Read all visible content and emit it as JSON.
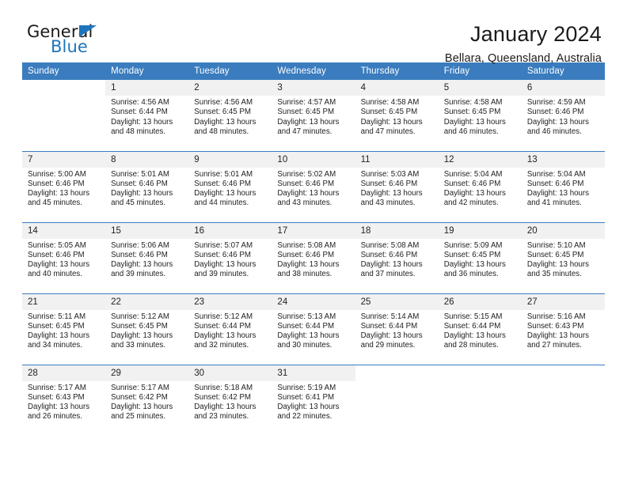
{
  "brand": {
    "name_part1": "General",
    "name_part2": "Blue",
    "accent_color": "#1c75bc"
  },
  "header": {
    "title": "January 2024",
    "subtitle": "Bellara, Queensland, Australia"
  },
  "theme": {
    "header_row_color": "#3a7cbe",
    "daynum_band_color": "#f1f1f1",
    "text_color": "#222222"
  },
  "weekday_headers": [
    "Sunday",
    "Monday",
    "Tuesday",
    "Wednesday",
    "Thursday",
    "Friday",
    "Saturday"
  ],
  "weeks": [
    [
      {
        "day": "",
        "lines": []
      },
      {
        "day": "1",
        "lines": [
          "Sunrise: 4:56 AM",
          "Sunset: 6:44 PM",
          "Daylight: 13 hours",
          "and 48 minutes."
        ]
      },
      {
        "day": "2",
        "lines": [
          "Sunrise: 4:56 AM",
          "Sunset: 6:45 PM",
          "Daylight: 13 hours",
          "and 48 minutes."
        ]
      },
      {
        "day": "3",
        "lines": [
          "Sunrise: 4:57 AM",
          "Sunset: 6:45 PM",
          "Daylight: 13 hours",
          "and 47 minutes."
        ]
      },
      {
        "day": "4",
        "lines": [
          "Sunrise: 4:58 AM",
          "Sunset: 6:45 PM",
          "Daylight: 13 hours",
          "and 47 minutes."
        ]
      },
      {
        "day": "5",
        "lines": [
          "Sunrise: 4:58 AM",
          "Sunset: 6:45 PM",
          "Daylight: 13 hours",
          "and 46 minutes."
        ]
      },
      {
        "day": "6",
        "lines": [
          "Sunrise: 4:59 AM",
          "Sunset: 6:46 PM",
          "Daylight: 13 hours",
          "and 46 minutes."
        ]
      }
    ],
    [
      {
        "day": "7",
        "lines": [
          "Sunrise: 5:00 AM",
          "Sunset: 6:46 PM",
          "Daylight: 13 hours",
          "and 45 minutes."
        ]
      },
      {
        "day": "8",
        "lines": [
          "Sunrise: 5:01 AM",
          "Sunset: 6:46 PM",
          "Daylight: 13 hours",
          "and 45 minutes."
        ]
      },
      {
        "day": "9",
        "lines": [
          "Sunrise: 5:01 AM",
          "Sunset: 6:46 PM",
          "Daylight: 13 hours",
          "and 44 minutes."
        ]
      },
      {
        "day": "10",
        "lines": [
          "Sunrise: 5:02 AM",
          "Sunset: 6:46 PM",
          "Daylight: 13 hours",
          "and 43 minutes."
        ]
      },
      {
        "day": "11",
        "lines": [
          "Sunrise: 5:03 AM",
          "Sunset: 6:46 PM",
          "Daylight: 13 hours",
          "and 43 minutes."
        ]
      },
      {
        "day": "12",
        "lines": [
          "Sunrise: 5:04 AM",
          "Sunset: 6:46 PM",
          "Daylight: 13 hours",
          "and 42 minutes."
        ]
      },
      {
        "day": "13",
        "lines": [
          "Sunrise: 5:04 AM",
          "Sunset: 6:46 PM",
          "Daylight: 13 hours",
          "and 41 minutes."
        ]
      }
    ],
    [
      {
        "day": "14",
        "lines": [
          "Sunrise: 5:05 AM",
          "Sunset: 6:46 PM",
          "Daylight: 13 hours",
          "and 40 minutes."
        ]
      },
      {
        "day": "15",
        "lines": [
          "Sunrise: 5:06 AM",
          "Sunset: 6:46 PM",
          "Daylight: 13 hours",
          "and 39 minutes."
        ]
      },
      {
        "day": "16",
        "lines": [
          "Sunrise: 5:07 AM",
          "Sunset: 6:46 PM",
          "Daylight: 13 hours",
          "and 39 minutes."
        ]
      },
      {
        "day": "17",
        "lines": [
          "Sunrise: 5:08 AM",
          "Sunset: 6:46 PM",
          "Daylight: 13 hours",
          "and 38 minutes."
        ]
      },
      {
        "day": "18",
        "lines": [
          "Sunrise: 5:08 AM",
          "Sunset: 6:46 PM",
          "Daylight: 13 hours",
          "and 37 minutes."
        ]
      },
      {
        "day": "19",
        "lines": [
          "Sunrise: 5:09 AM",
          "Sunset: 6:45 PM",
          "Daylight: 13 hours",
          "and 36 minutes."
        ]
      },
      {
        "day": "20",
        "lines": [
          "Sunrise: 5:10 AM",
          "Sunset: 6:45 PM",
          "Daylight: 13 hours",
          "and 35 minutes."
        ]
      }
    ],
    [
      {
        "day": "21",
        "lines": [
          "Sunrise: 5:11 AM",
          "Sunset: 6:45 PM",
          "Daylight: 13 hours",
          "and 34 minutes."
        ]
      },
      {
        "day": "22",
        "lines": [
          "Sunrise: 5:12 AM",
          "Sunset: 6:45 PM",
          "Daylight: 13 hours",
          "and 33 minutes."
        ]
      },
      {
        "day": "23",
        "lines": [
          "Sunrise: 5:12 AM",
          "Sunset: 6:44 PM",
          "Daylight: 13 hours",
          "and 32 minutes."
        ]
      },
      {
        "day": "24",
        "lines": [
          "Sunrise: 5:13 AM",
          "Sunset: 6:44 PM",
          "Daylight: 13 hours",
          "and 30 minutes."
        ]
      },
      {
        "day": "25",
        "lines": [
          "Sunrise: 5:14 AM",
          "Sunset: 6:44 PM",
          "Daylight: 13 hours",
          "and 29 minutes."
        ]
      },
      {
        "day": "26",
        "lines": [
          "Sunrise: 5:15 AM",
          "Sunset: 6:44 PM",
          "Daylight: 13 hours",
          "and 28 minutes."
        ]
      },
      {
        "day": "27",
        "lines": [
          "Sunrise: 5:16 AM",
          "Sunset: 6:43 PM",
          "Daylight: 13 hours",
          "and 27 minutes."
        ]
      }
    ],
    [
      {
        "day": "28",
        "lines": [
          "Sunrise: 5:17 AM",
          "Sunset: 6:43 PM",
          "Daylight: 13 hours",
          "and 26 minutes."
        ]
      },
      {
        "day": "29",
        "lines": [
          "Sunrise: 5:17 AM",
          "Sunset: 6:42 PM",
          "Daylight: 13 hours",
          "and 25 minutes."
        ]
      },
      {
        "day": "30",
        "lines": [
          "Sunrise: 5:18 AM",
          "Sunset: 6:42 PM",
          "Daylight: 13 hours",
          "and 23 minutes."
        ]
      },
      {
        "day": "31",
        "lines": [
          "Sunrise: 5:19 AM",
          "Sunset: 6:41 PM",
          "Daylight: 13 hours",
          "and 22 minutes."
        ]
      },
      {
        "day": "",
        "lines": []
      },
      {
        "day": "",
        "lines": []
      },
      {
        "day": "",
        "lines": []
      }
    ]
  ]
}
